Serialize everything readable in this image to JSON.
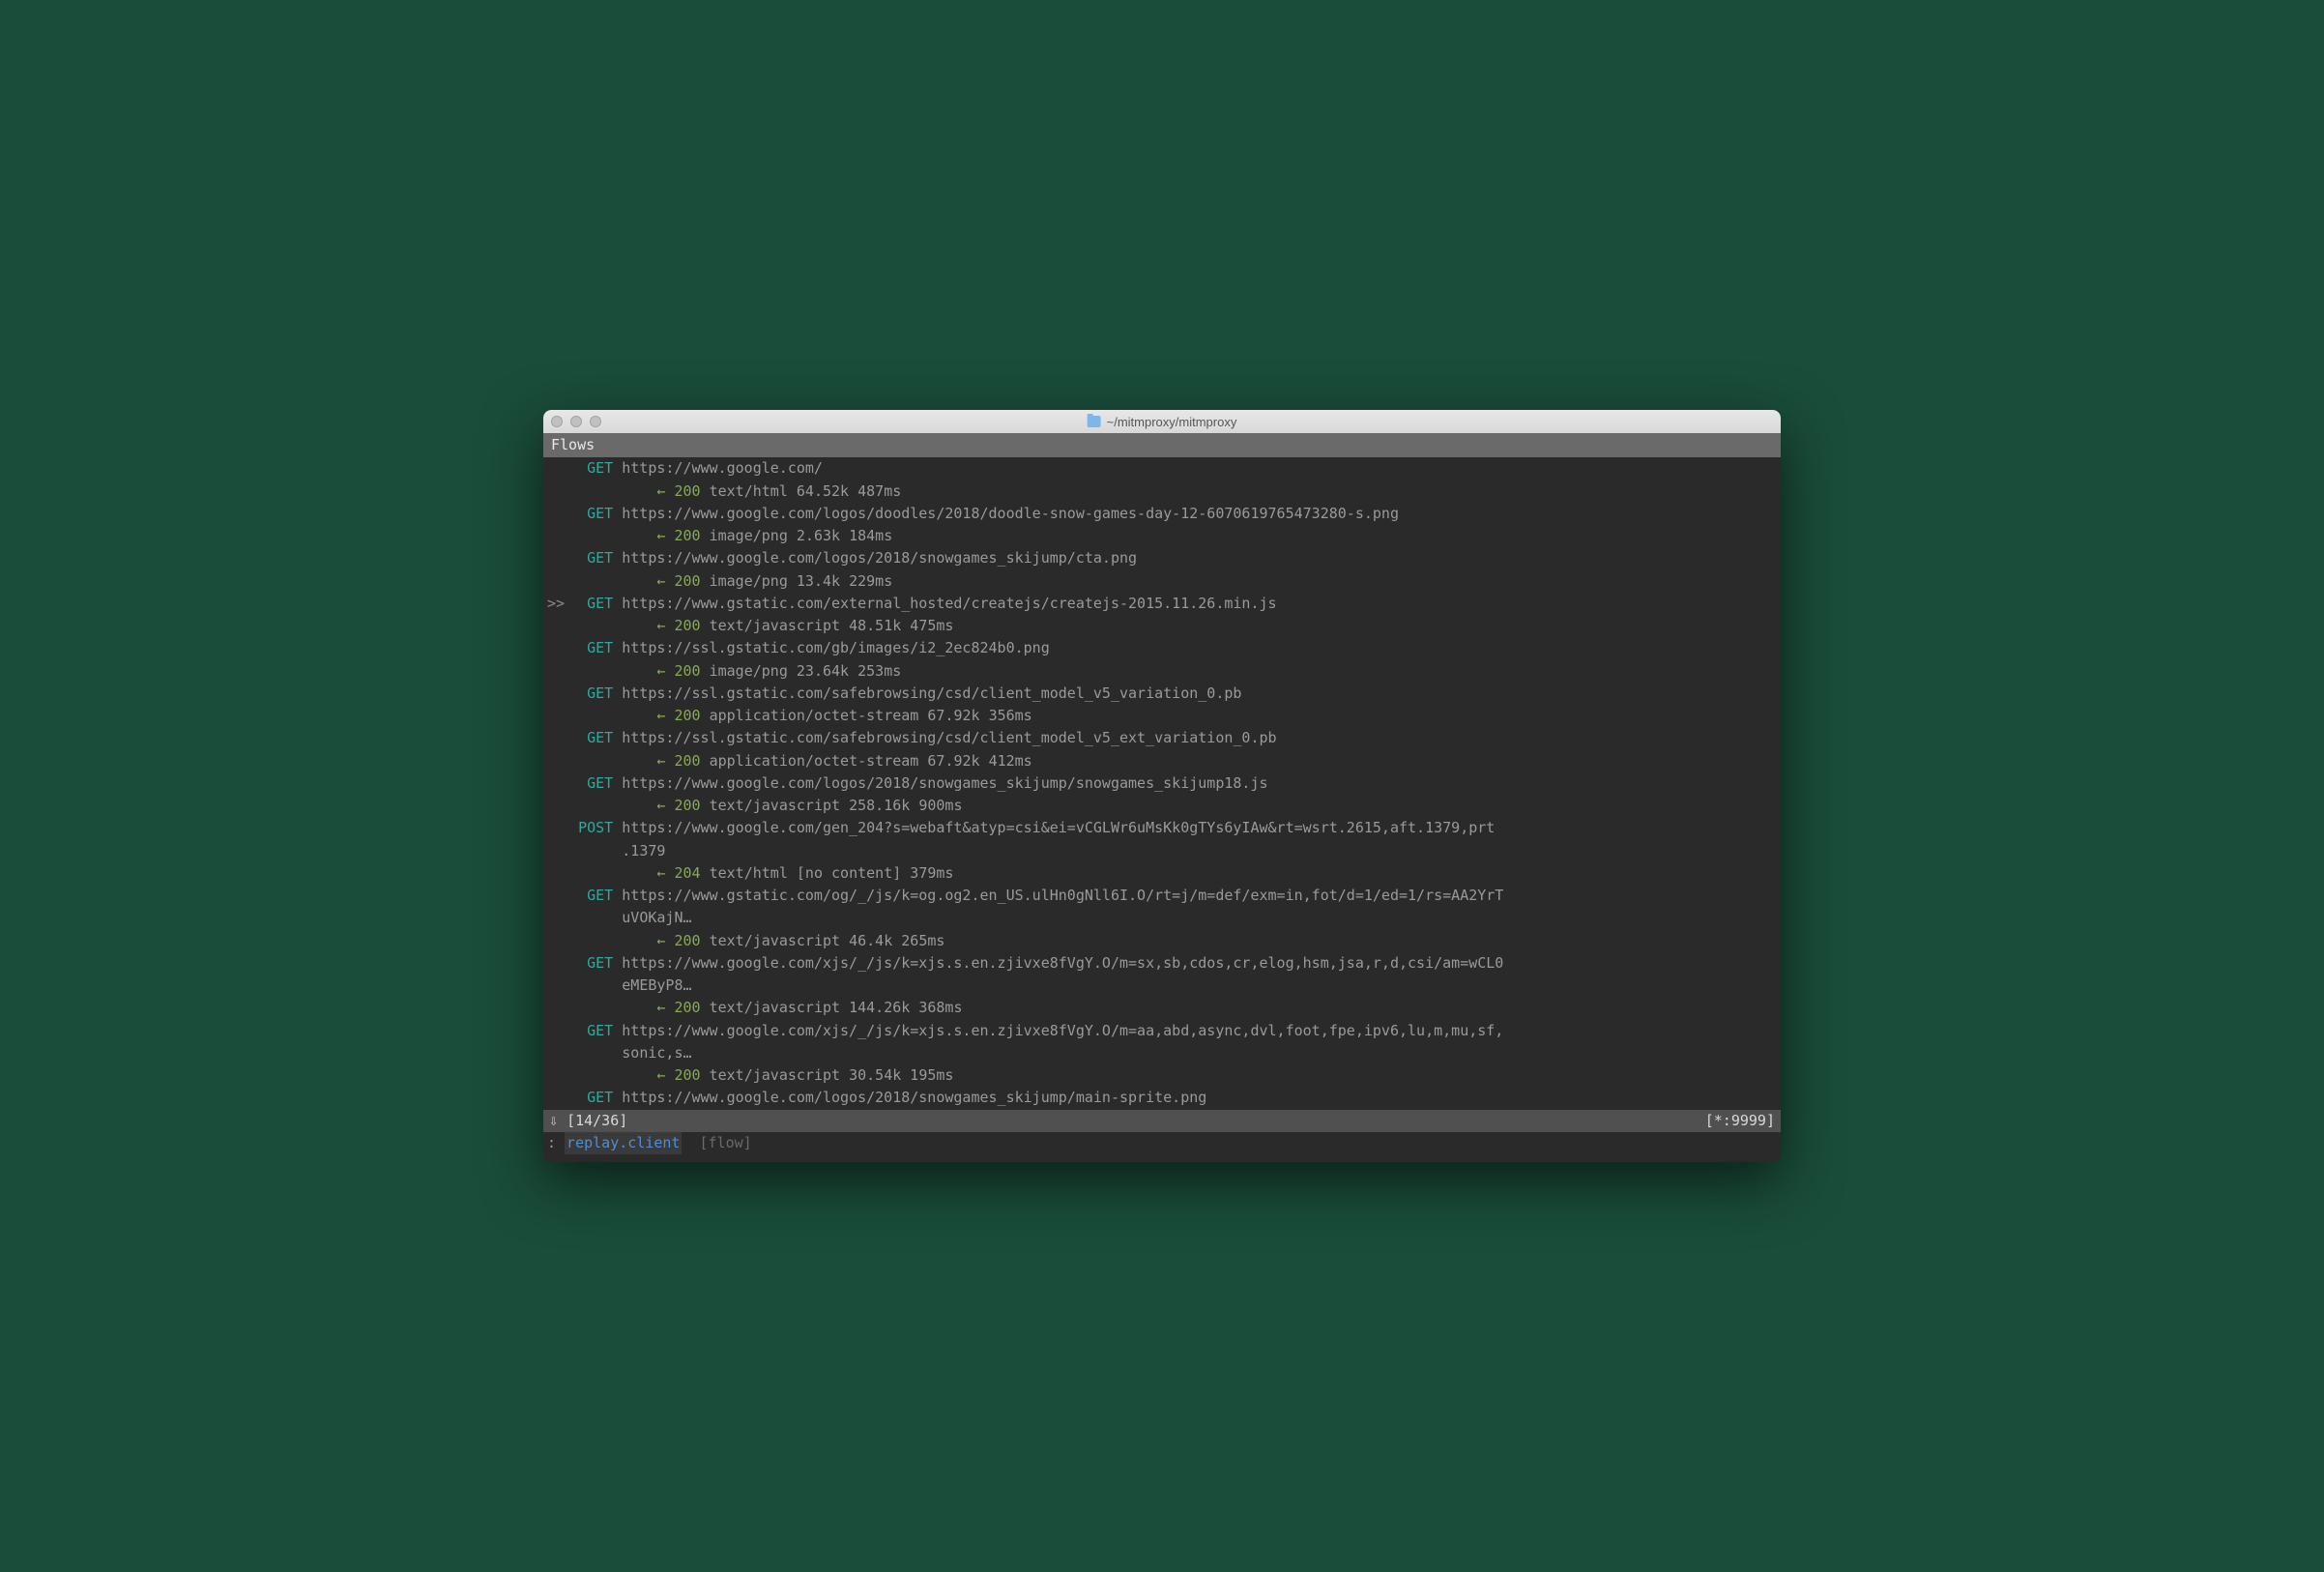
{
  "window": {
    "title": "~/mitmproxy/mitmproxy"
  },
  "header": {
    "label": "Flows"
  },
  "flows": [
    {
      "selected": false,
      "method": "GET",
      "url": "https://www.google.com/",
      "resp": {
        "arrow": "←",
        "status": "200",
        "meta": "text/html 64.52k 487ms"
      }
    },
    {
      "selected": false,
      "method": "GET",
      "url": "https://www.google.com/logos/doodles/2018/doodle-snow-games-day-12-6070619765473280-s.png",
      "resp": {
        "arrow": "←",
        "status": "200",
        "meta": "image/png 2.63k 184ms"
      }
    },
    {
      "selected": false,
      "method": "GET",
      "url": "https://www.google.com/logos/2018/snowgames_skijump/cta.png",
      "resp": {
        "arrow": "←",
        "status": "200",
        "meta": "image/png 13.4k 229ms"
      }
    },
    {
      "selected": true,
      "method": "GET",
      "url": "https://www.gstatic.com/external_hosted/createjs/createjs-2015.11.26.min.js",
      "resp": {
        "arrow": "←",
        "status": "200",
        "meta": "text/javascript 48.51k 475ms"
      }
    },
    {
      "selected": false,
      "method": "GET",
      "url": "https://ssl.gstatic.com/gb/images/i2_2ec824b0.png",
      "resp": {
        "arrow": "←",
        "status": "200",
        "meta": "image/png 23.64k 253ms"
      }
    },
    {
      "selected": false,
      "method": "GET",
      "url": "https://ssl.gstatic.com/safebrowsing/csd/client_model_v5_variation_0.pb",
      "resp": {
        "arrow": "←",
        "status": "200",
        "meta": "application/octet-stream 67.92k 356ms"
      }
    },
    {
      "selected": false,
      "method": "GET",
      "url": "https://ssl.gstatic.com/safebrowsing/csd/client_model_v5_ext_variation_0.pb",
      "resp": {
        "arrow": "←",
        "status": "200",
        "meta": "application/octet-stream 67.92k 412ms"
      }
    },
    {
      "selected": false,
      "method": "GET",
      "url": "https://www.google.com/logos/2018/snowgames_skijump/snowgames_skijump18.js",
      "resp": {
        "arrow": "←",
        "status": "200",
        "meta": "text/javascript 258.16k 900ms"
      }
    },
    {
      "selected": false,
      "method": "POST",
      "url": "https://www.google.com/gen_204?s=webaft&atyp=csi&ei=vCGLWr6uMsKk0gTYs6yIAw&rt=wsrt.2615,aft.1379,prt",
      "url_cont": ".1379",
      "resp": {
        "arrow": "←",
        "status": "204",
        "meta": "text/html [no content] 379ms"
      }
    },
    {
      "selected": false,
      "method": "GET",
      "url": "https://www.gstatic.com/og/_/js/k=og.og2.en_US.ulHn0gNll6I.O/rt=j/m=def/exm=in,fot/d=1/ed=1/rs=AA2YrT",
      "url_cont": "uVOKajN…",
      "resp": {
        "arrow": "←",
        "status": "200",
        "meta": "text/javascript 46.4k 265ms"
      }
    },
    {
      "selected": false,
      "method": "GET",
      "url": "https://www.google.com/xjs/_/js/k=xjs.s.en.zjivxe8fVgY.O/m=sx,sb,cdos,cr,elog,hsm,jsa,r,d,csi/am=wCL0",
      "url_cont": "eMEByP8…",
      "resp": {
        "arrow": "←",
        "status": "200",
        "meta": "text/javascript 144.26k 368ms"
      }
    },
    {
      "selected": false,
      "method": "GET",
      "url": "https://www.google.com/xjs/_/js/k=xjs.s.en.zjivxe8fVgY.O/m=aa,abd,async,dvl,foot,fpe,ipv6,lu,m,mu,sf,",
      "url_cont": "sonic,s…",
      "resp": {
        "arrow": "←",
        "status": "200",
        "meta": "text/javascript 30.54k 195ms"
      }
    },
    {
      "selected": false,
      "method": "GET",
      "url": "https://www.google.com/logos/2018/snowgames_skijump/main-sprite.png",
      "resp": null
    }
  ],
  "statusbar": {
    "down_arrow": "⇩",
    "position": "[14/36]",
    "right": "[*:9999]"
  },
  "cmdline": {
    "prompt": ":",
    "command": "replay.client",
    "hint": "[flow]"
  }
}
